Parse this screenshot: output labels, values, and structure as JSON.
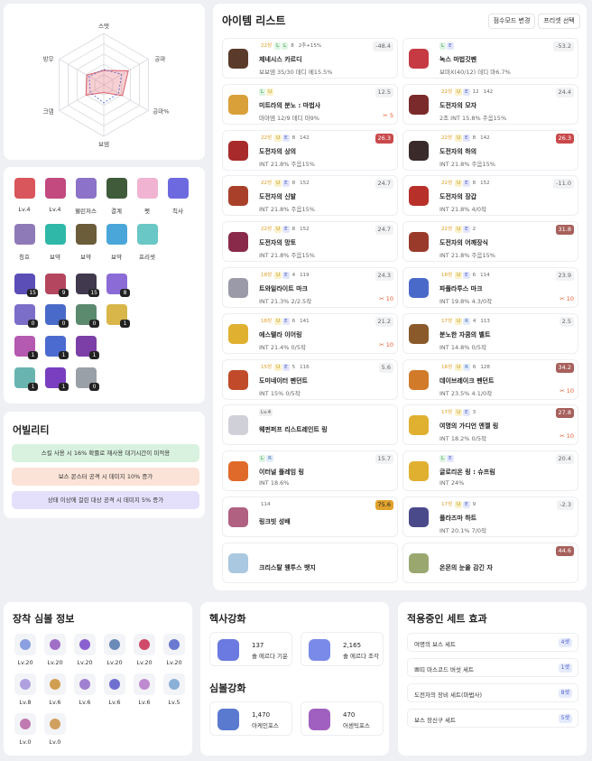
{
  "radar": {
    "axes": [
      "스탯",
      "공마",
      "공마%",
      "보뎀",
      "크뎀",
      "방무"
    ]
  },
  "equip": {
    "slots": [
      {
        "label": "Lv.4",
        "color": "#d9565c"
      },
      {
        "label": "Lv.4",
        "color": "#c24a7e"
      },
      {
        "label": "웰린저스",
        "color": "#8c73c9"
      },
      {
        "label": "결계",
        "color": "#3f5b3a"
      },
      {
        "label": "펫",
        "color": "#f0b4d2"
      },
      {
        "label": "칙사",
        "color": "#6d6ae0"
      },
      {
        "label": "칭호",
        "color": "#8f7ab8"
      },
      {
        "label": "보약",
        "color": "#2fb8a8"
      },
      {
        "label": "보약",
        "color": "#6b5c3a"
      },
      {
        "label": "보약",
        "color": "#4aa6d8"
      },
      {
        "label": "프리셋",
        "color": "#69c7c6"
      }
    ],
    "skills": [
      {
        "badge": "15",
        "color": "#5b4fb7"
      },
      {
        "badge": "9",
        "color": "#b4475f"
      },
      {
        "badge": "15",
        "color": "#41394e"
      },
      {
        "badge": "8",
        "color": "#8b6bd6"
      },
      {
        "badge": "0",
        "color": "#7b6ec9"
      },
      {
        "badge": "0",
        "color": "#4a6ac9"
      },
      {
        "badge": "0",
        "color": "#5b8a6f"
      },
      {
        "badge": "1",
        "color": "#d8b64a"
      },
      {
        "badge": "1",
        "color": "#b45ab0"
      },
      {
        "badge": "1",
        "color": "#4c6bd1"
      },
      {
        "badge": "1",
        "color": "#7b3fa7"
      },
      {
        "badge": "1",
        "color": "#6ab4b0"
      },
      {
        "badge": "1",
        "color": "#7a3fc0"
      },
      {
        "badge": "0",
        "color": "#9aa0a8"
      }
    ]
  },
  "ability": {
    "title": "어빌리티",
    "lines": [
      {
        "text": "스킬 사용 시 16% 확률로 재사용 대기시간이 미적용",
        "bg": "#d9f2df"
      },
      {
        "text": "보스 몬스터 공격 시 데미지 10% 증가",
        "bg": "#fbe3d7"
      },
      {
        "text": "상태 이상에 걸린 대상 공격 시 데미지 5% 증가",
        "bg": "#e4e0fb"
      }
    ]
  },
  "items": {
    "title": "아이템 리스트",
    "btn_score": "점수모드 변경",
    "btn_preset": "프리셋 선택",
    "list": [
      {
        "star": "22성",
        "tags": [
          "L",
          "L"
        ],
        "upg": "8",
        "extra": "2추+15%",
        "name": "제네시스 카르디",
        "stat": "보보뎀 35/30 데디 메15.5%",
        "value": "-48.4",
        "vclass": "",
        "scroll": "",
        "color": "#5a3a2a"
      },
      {
        "star": "",
        "tags": [
          "L",
          "E"
        ],
        "upg": "",
        "extra": "",
        "name": "녹스 마법깃펜",
        "stat": "보마X(40/12) 데디 마6.7%",
        "value": "-53.2",
        "vclass": "",
        "scroll": "",
        "color": "#c63a44"
      },
      {
        "star": "",
        "tags": [
          "L",
          "U"
        ],
        "upg": "",
        "extra": "",
        "name": "미트라의 분노 : 마법사",
        "stat": "마마뎀 12/9 데디 마9%",
        "value": "12.5",
        "vclass": "",
        "scroll": "5",
        "color": "#d9a03a"
      },
      {
        "star": "22성",
        "tags": [
          "U",
          "E"
        ],
        "upg": "12",
        "extra": "142",
        "name": "도전자의 모자",
        "stat": "2조 INT 15.8%  주음15%",
        "value": "24.4",
        "vclass": "",
        "scroll": "",
        "color": "#7a2a2a"
      },
      {
        "star": "22성",
        "tags": [
          "U",
          "E"
        ],
        "upg": "8",
        "extra": "142",
        "name": "도전자의 상의",
        "stat": "INT 21.8%  주음15%",
        "value": "26.3",
        "vclass": "hot",
        "scroll": "",
        "color": "#a82a2a"
      },
      {
        "star": "22성",
        "tags": [
          "U",
          "E"
        ],
        "upg": "8",
        "extra": "142",
        "name": "도전자의 하의",
        "stat": "INT 21.8%  주음15%",
        "value": "26.3",
        "vclass": "hot",
        "scroll": "",
        "color": "#3a2a2a"
      },
      {
        "star": "22성",
        "tags": [
          "U",
          "E"
        ],
        "upg": "8",
        "extra": "152",
        "name": "도전자의 신발",
        "stat": "INT 21.8%  주음15%",
        "value": "24.7",
        "vclass": "",
        "scroll": "",
        "color": "#a8402a"
      },
      {
        "star": "22성",
        "tags": [
          "U",
          "E"
        ],
        "upg": "8",
        "extra": "152",
        "name": "도전자의 장갑",
        "stat": "INT 21.8%  4/0작",
        "value": "-11.0",
        "vclass": "",
        "scroll": "",
        "color": "#b8302a"
      },
      {
        "star": "22성",
        "tags": [
          "U",
          "E"
        ],
        "upg": "8",
        "extra": "152",
        "name": "도전자의 망토",
        "stat": "INT 21.8%  주음15%",
        "value": "24.7",
        "vclass": "",
        "scroll": "",
        "color": "#8a2a4a"
      },
      {
        "star": "22성",
        "tags": [
          "U",
          "E"
        ],
        "upg": "2",
        "extra": "",
        "name": "도전자의 어깨장식",
        "stat": "INT 21.8%  주음15%",
        "value": "31.8",
        "vclass": "warm",
        "scroll": "",
        "color": "#9a3a2a"
      },
      {
        "star": "18성",
        "tags": [
          "U",
          "E"
        ],
        "upg": "4",
        "extra": "119",
        "name": "트와일라이트 마크",
        "stat": "INT 21.3%  2/2.5작",
        "value": "24.3",
        "vclass": "",
        "scroll": "10",
        "color": "#9a9aa8"
      },
      {
        "star": "18성",
        "tags": [
          "U",
          "E"
        ],
        "upg": "6",
        "extra": "114",
        "name": "파풀라투스 마크",
        "stat": "INT 19.8%  4.3/0작",
        "value": "23.9",
        "vclass": "",
        "scroll": "10",
        "color": "#4a6ac9"
      },
      {
        "star": "18성",
        "tags": [
          "U",
          "E"
        ],
        "upg": "6",
        "extra": "141",
        "name": "에스텔라 이어링",
        "stat": "INT 21.4%  0/5작",
        "value": "21.2",
        "vclass": "",
        "scroll": "10",
        "color": "#e0b030"
      },
      {
        "star": "17성",
        "tags": [
          "U",
          "R"
        ],
        "upg": "4",
        "extra": "113",
        "name": "분노한 자쿰의 벨트",
        "stat": "INT 14.8%  0/5작",
        "value": "2.5",
        "vclass": "",
        "scroll": "",
        "color": "#8a5a2a"
      },
      {
        "star": "15성",
        "tags": [
          "U",
          "E"
        ],
        "upg": "5",
        "extra": "116",
        "name": "도미네이터 펜던트",
        "stat": "INT 15%  0/5작",
        "value": "5.6",
        "vclass": "",
        "scroll": "",
        "color": "#c04a2a"
      },
      {
        "star": "18성",
        "tags": [
          "U",
          "R"
        ],
        "upg": "6",
        "extra": "128",
        "name": "데이브레이크 펜던트",
        "stat": "INT 23.5%  4.1/0작",
        "value": "34.2",
        "vclass": "warm",
        "scroll": "10",
        "color": "#d07a2a"
      },
      {
        "star": "",
        "tags": [
          "Lv.4"
        ],
        "upg": "",
        "extra": "",
        "name": "웨펀퍼프 리스트레인트 링",
        "stat": "",
        "value": "",
        "vclass": "",
        "scroll": "",
        "color": "#d0d0d8"
      },
      {
        "star": "17성",
        "tags": [
          "U",
          "E"
        ],
        "upg": "3",
        "extra": "",
        "name": "여명의 가디언 엔젤 링",
        "stat": "INT 18.2%  0/5작",
        "value": "27.8",
        "vclass": "warm",
        "scroll": "10",
        "color": "#e0b030"
      },
      {
        "star": "",
        "tags": [
          "L",
          "R"
        ],
        "upg": "",
        "extra": "",
        "name": "이터널 플레임 링",
        "stat": "INT 18.6%",
        "value": "15.7",
        "vclass": "",
        "scroll": "",
        "color": "#e06a2a"
      },
      {
        "star": "",
        "tags": [
          "L",
          "E"
        ],
        "upg": "",
        "extra": "",
        "name": "글로리온 링 : 슈프림",
        "stat": "INT 24%",
        "value": "20.4",
        "vclass": "",
        "scroll": "",
        "color": "#e0b030"
      },
      {
        "star": "",
        "tags": [],
        "upg": "",
        "extra": "114",
        "name": "링크빗 성배",
        "stat": "",
        "value": "75.6",
        "vclass": "gold",
        "scroll": "",
        "color": "#b06080"
      },
      {
        "star": "17성",
        "tags": [
          "U",
          "E"
        ],
        "upg": "9",
        "extra": "",
        "name": "플라즈마 하트",
        "stat": "INT 20.1%  7/0작",
        "value": "-2.3",
        "vclass": "",
        "scroll": "",
        "color": "#4a4a8a"
      },
      {
        "star": "",
        "tags": [],
        "upg": "",
        "extra": "",
        "name": "크리스탈 웬투스 뱃지",
        "stat": "",
        "value": "",
        "vclass": "",
        "scroll": "",
        "color": "#aac8e0"
      },
      {
        "star": "",
        "tags": [],
        "upg": "",
        "extra": "",
        "name": "온몬의 눈을 감긴 자",
        "stat": "",
        "value": "44.6",
        "vclass": "warm",
        "scroll": "",
        "color": "#9aa870"
      }
    ]
  },
  "symbols": {
    "title": "장착 심볼 정보",
    "list": [
      {
        "label": "Lv.20",
        "color": "#8aa0e0"
      },
      {
        "label": "Lv.20",
        "color": "#a070c8"
      },
      {
        "label": "Lv.20",
        "color": "#8a60d0"
      },
      {
        "label": "Lv.20",
        "color": "#6a8ab8"
      },
      {
        "label": "Lv.20",
        "color": "#d04a6a"
      },
      {
        "label": "Lv.20",
        "color": "#6a7ad0"
      },
      {
        "label": "Lv.8",
        "color": "#b0a0e0"
      },
      {
        "label": "Lv.6",
        "color": "#d0a050"
      },
      {
        "label": "Lv.6",
        "color": "#a080d0"
      },
      {
        "label": "Lv.6",
        "color": "#7070d0"
      },
      {
        "label": "Lv.6",
        "color": "#c08ad0"
      },
      {
        "label": "Lv.5",
        "color": "#8ab0d8"
      },
      {
        "label": "Lv.0",
        "color": "#c07ab0"
      },
      {
        "label": "Lv.0",
        "color": "#d0a060"
      }
    ]
  },
  "hexa": {
    "title": "헥사강화",
    "items": [
      {
        "value": "137",
        "name": "솔 에르다 기운",
        "color": "#6a7ae0"
      },
      {
        "value": "2,165",
        "name": "솔 에르다 조각",
        "color": "#7a8ae8"
      }
    ],
    "symbol_title": "심볼강화",
    "symbol_items": [
      {
        "value": "1,470",
        "name": "아케인포스",
        "color": "#5a7ad0"
      },
      {
        "value": "470",
        "name": "어센틱포스",
        "color": "#a060c0"
      }
    ]
  },
  "sets": {
    "title": "적용중인 세트 효과",
    "list": [
      {
        "name": "여명의 보스 세트",
        "count": "4셋"
      },
      {
        "name": "쁘띠 마스코드 버섯 세트",
        "count": "1셋"
      },
      {
        "name": "도전자의 장비 세트(마법사)",
        "count": "8셋"
      },
      {
        "name": "보스 장신구 세트",
        "count": "5셋"
      }
    ]
  }
}
